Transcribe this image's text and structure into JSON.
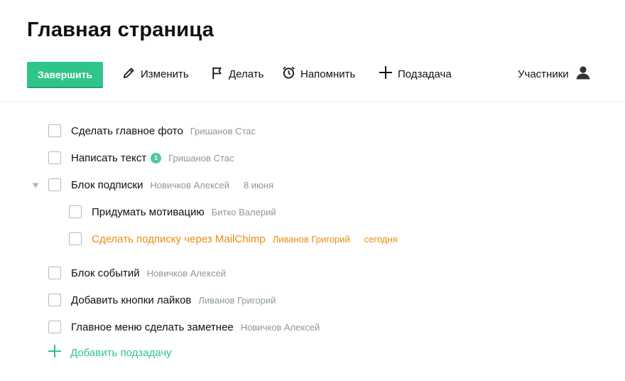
{
  "page": {
    "title": "Главная страница"
  },
  "toolbar": {
    "complete": "Завершить",
    "edit": "Изменить",
    "do": "Делать",
    "remind": "Напомнить",
    "subtask": "Подзадача",
    "members": "Участники"
  },
  "tasks": [
    {
      "title": "Сделать главное фото",
      "assignee": "Гришанов Стас"
    },
    {
      "title": "Написать текст",
      "badge": "1",
      "assignee": "Гришанов Стас"
    },
    {
      "title": "Блок подписки",
      "assignee": "Новичков Алексей",
      "due": "8 июня",
      "expanded": true,
      "subtasks": [
        {
          "title": "Придумать мотивацию",
          "assignee": "Битко Валерий"
        },
        {
          "title": "Сделать подписку через MailChimp",
          "assignee": "Ливанов Григорий",
          "due": "сегодня",
          "overdue": true
        }
      ]
    },
    {
      "title": "Блок событий",
      "assignee": "Новичков Алексей"
    },
    {
      "title": "Добавить кнопки лайков",
      "assignee": "Ливанов Григорий"
    },
    {
      "title": "Главное меню сделать заметнее",
      "assignee": "Новичков Алексей"
    }
  ],
  "add_subtask": "Добавить подзадачу",
  "colors": {
    "accent": "#2fc58a",
    "overdue": "#ef8a12",
    "meta": "#8a9a94",
    "badge": "#4fc7a4"
  },
  "icons": [
    "pencil-icon",
    "flag-icon",
    "alarm-clock-icon",
    "plus-icon",
    "user-icon",
    "expand-triangle-icon"
  ]
}
